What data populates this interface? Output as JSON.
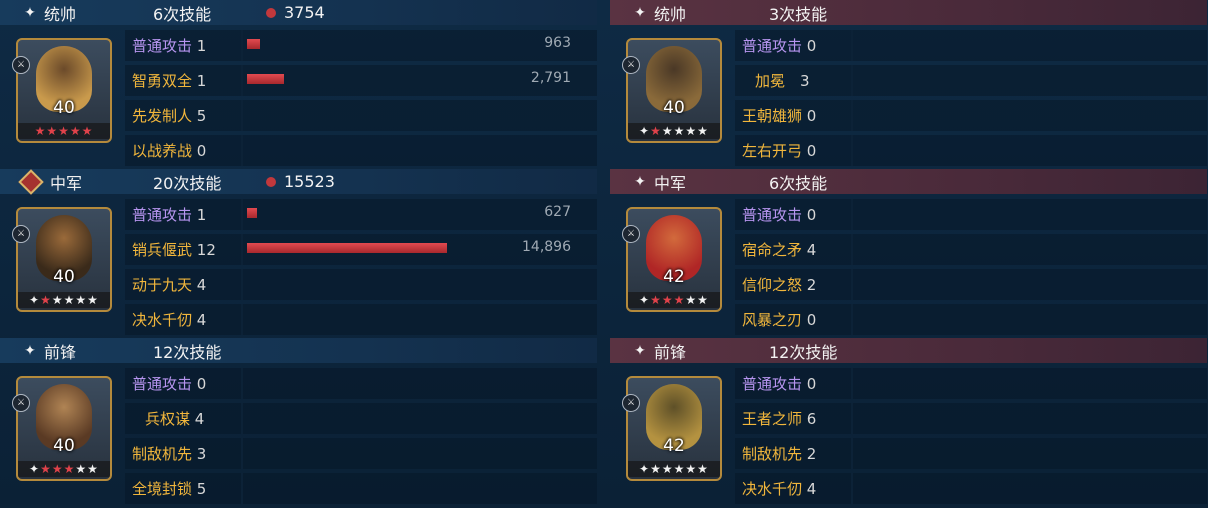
{
  "left": [
    {
      "role": "统帅",
      "role_icon": "spark-icon",
      "skill_count": "6次技能",
      "damage": "3754",
      "level": "40",
      "stars": [
        1,
        1,
        1,
        1,
        1
      ],
      "rows": [
        {
          "name": "普通攻击",
          "times": "1",
          "value": 963,
          "value_text": "963"
        },
        {
          "name": "智勇双全",
          "times": "1",
          "value": 2791,
          "value_text": "2,791"
        },
        {
          "name": "先发制人",
          "times": "5",
          "value": 0,
          "value_text": ""
        },
        {
          "name": "以战养战",
          "times": "0",
          "value": 0,
          "value_text": ""
        }
      ]
    },
    {
      "role": "中军",
      "role_icon": "diamond-icon",
      "skill_count": "20次技能",
      "damage": "15523",
      "level": "40",
      "stars": [
        0,
        1,
        0,
        0,
        0,
        0
      ],
      "rows": [
        {
          "name": "普通攻击",
          "times": "1",
          "value": 627,
          "value_text": "627"
        },
        {
          "name": "销兵偃武",
          "times": "12",
          "value": 14896,
          "value_text": "14,896"
        },
        {
          "name": "动于九天",
          "times": "4",
          "value": 0,
          "value_text": ""
        },
        {
          "name": "决水千仞",
          "times": "4",
          "value": 0,
          "value_text": ""
        }
      ]
    },
    {
      "role": "前锋",
      "role_icon": "spark-icon",
      "skill_count": "12次技能",
      "damage": "",
      "level": "40",
      "stars": [
        0,
        1,
        1,
        1,
        0,
        0
      ],
      "rows": [
        {
          "name": "普通攻击",
          "times": "0",
          "value": 0,
          "value_text": ""
        },
        {
          "name": "兵权谋",
          "times": "4",
          "value": 0,
          "value_text": ""
        },
        {
          "name": "制敌机先",
          "times": "3",
          "value": 0,
          "value_text": ""
        },
        {
          "name": "全境封锁",
          "times": "5",
          "value": 0,
          "value_text": ""
        }
      ]
    }
  ],
  "right": [
    {
      "role": "统帅",
      "role_icon": "spark-icon",
      "skill_count": "3次技能",
      "damage": "",
      "level": "40",
      "stars": [
        0,
        1,
        0,
        0,
        0,
        0
      ],
      "rows": [
        {
          "name": "普通攻击",
          "times": "0",
          "value": 0,
          "value_text": ""
        },
        {
          "name": "加冕",
          "times": "3",
          "value": 0,
          "value_text": ""
        },
        {
          "name": "王朝雄狮",
          "times": "0",
          "value": 0,
          "value_text": ""
        },
        {
          "name": "左右开弓",
          "times": "0",
          "value": 0,
          "value_text": ""
        }
      ]
    },
    {
      "role": "中军",
      "role_icon": "spark-icon",
      "skill_count": "6次技能",
      "damage": "",
      "level": "42",
      "stars": [
        0,
        1,
        1,
        1,
        0,
        0
      ],
      "rows": [
        {
          "name": "普通攻击",
          "times": "0",
          "value": 0,
          "value_text": ""
        },
        {
          "name": "宿命之矛",
          "times": "4",
          "value": 0,
          "value_text": ""
        },
        {
          "name": "信仰之怒",
          "times": "2",
          "value": 0,
          "value_text": ""
        },
        {
          "name": "风暴之刃",
          "times": "0",
          "value": 0,
          "value_text": ""
        }
      ]
    },
    {
      "role": "前锋",
      "role_icon": "spark-icon",
      "skill_count": "12次技能",
      "damage": "",
      "level": "42",
      "stars": [
        0,
        0,
        0,
        0,
        0,
        0
      ],
      "rows": [
        {
          "name": "普通攻击",
          "times": "0",
          "value": 0,
          "value_text": ""
        },
        {
          "name": "王者之师",
          "times": "6",
          "value": 0,
          "value_text": ""
        },
        {
          "name": "制敌机先",
          "times": "2",
          "value": 0,
          "value_text": ""
        },
        {
          "name": "决水千仞",
          "times": "4",
          "value": 0,
          "value_text": ""
        }
      ]
    }
  ],
  "colors": {
    "bar": "#c2383c",
    "basic_attack": "#b795f0",
    "skill": "#f1b63c"
  }
}
